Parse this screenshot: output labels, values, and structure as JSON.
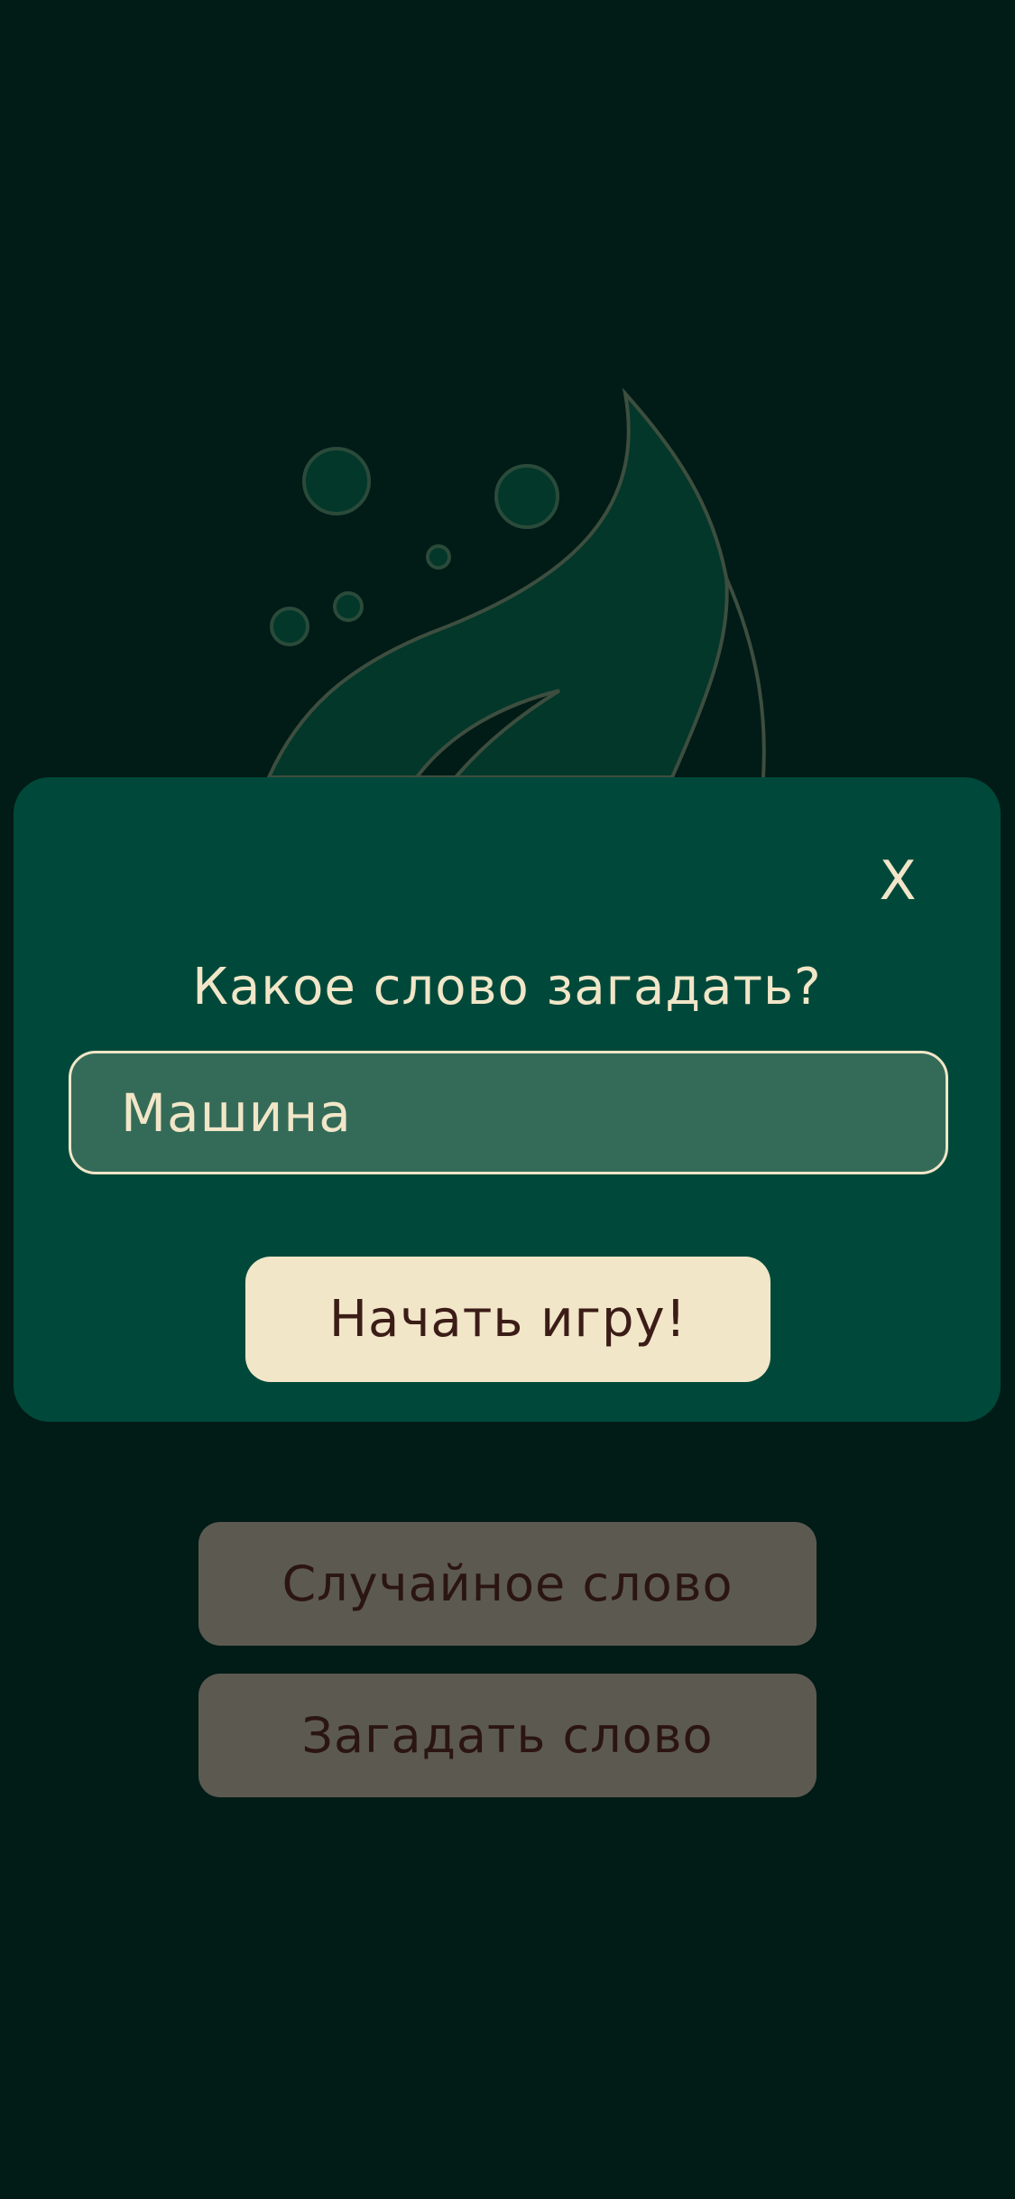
{
  "modal": {
    "close_label": "X",
    "title": "Какое слово загадать?",
    "input_value": "Машина",
    "start_label": "Начать игру!"
  },
  "menu": {
    "random_word_label": "Случайное слово",
    "make_word_label": "Загадать слово"
  },
  "colors": {
    "background": "#011b17",
    "modal_background": "#00493a",
    "input_background": "#346b58",
    "accent_cream": "#f1e6c8",
    "menu_button": "#5c5a50",
    "dark_text": "#3b1c17"
  },
  "icons": {
    "logo": "leaf-bubbles-logo"
  }
}
